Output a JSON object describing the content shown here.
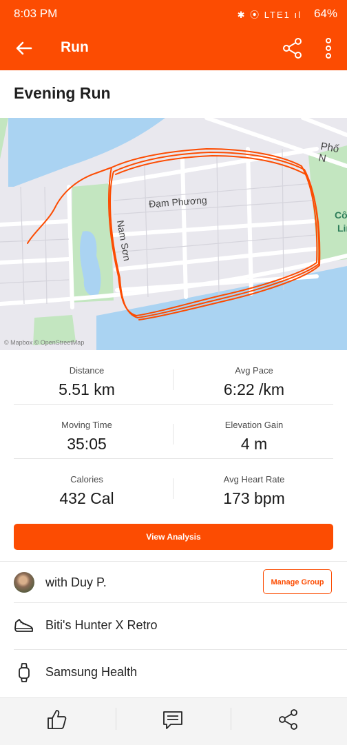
{
  "status_bar": {
    "time": "8:03 PM",
    "battery": "64%",
    "icons": "✱ ⦿ LTE1 ıl"
  },
  "header": {
    "title": "Run"
  },
  "activity": {
    "title": "Evening Run"
  },
  "map": {
    "street_labels": [
      "Đạm Phương",
      "Nam Sơn",
      "Phố N",
      "Cô",
      "Lin"
    ],
    "attribution": "© Mapbox © OpenStreetMap"
  },
  "stats": [
    {
      "label": "Distance",
      "value": "5.51 km"
    },
    {
      "label": "Avg Pace",
      "value": "6:22 /km"
    },
    {
      "label": "Moving Time",
      "value": "35:05"
    },
    {
      "label": "Elevation Gain",
      "value": "4 m"
    },
    {
      "label": "Calories",
      "value": "432 Cal"
    },
    {
      "label": "Avg Heart Rate",
      "value": "173 bpm"
    }
  ],
  "analysis_button": "View Analysis",
  "group": {
    "text": "with Duy P.",
    "manage_button": "Manage Group"
  },
  "gear": {
    "text": "Biti's Hunter X Retro"
  },
  "device": {
    "text": "Samsung Health"
  },
  "colors": {
    "brand": "#fc4c02",
    "water": "#aad3f2",
    "park": "#c3e6c0"
  },
  "icons": [
    "back-arrow-icon",
    "share-icon",
    "more-vertical-icon",
    "shoe-icon",
    "watch-icon",
    "thumbs-up-icon",
    "comment-icon"
  ]
}
